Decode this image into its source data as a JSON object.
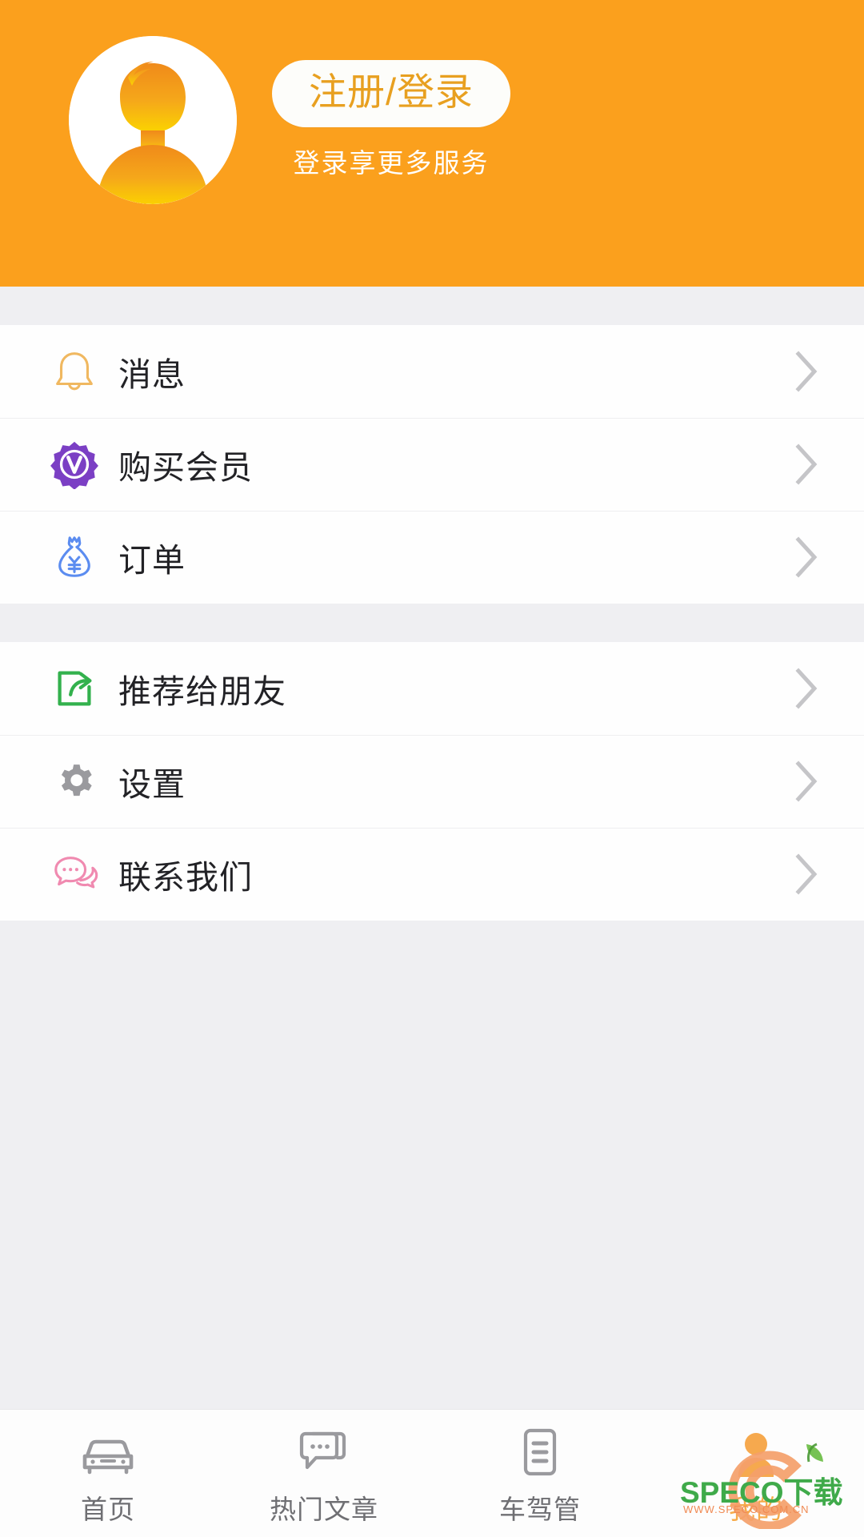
{
  "theme": {
    "brand_orange": "#fba01d",
    "page_bg": "#efeff2",
    "row_bg": "#fefefe",
    "divider": "#eeeef0",
    "label_color": "#222226",
    "chevron_color": "#c5c5c8",
    "active_tab_color": "#f6ab4a",
    "inactive_tab_color": "#6f6f73"
  },
  "header": {
    "avatar_icon": "default-user-avatar-icon",
    "login_button_label": "注册/登录",
    "login_subtitle": "登录享更多服务"
  },
  "menu": {
    "groups": [
      {
        "items": [
          {
            "icon": "bell-icon",
            "icon_color": "#f0b860",
            "label": "消息",
            "chevron": "chevron-right-icon"
          },
          {
            "icon": "vip-badge-icon",
            "icon_color": "#7b3fc4",
            "label": "购买会员",
            "chevron": "chevron-right-icon"
          },
          {
            "icon": "money-bag-icon",
            "icon_color": "#5b8cf0",
            "label": "订单",
            "chevron": "chevron-right-icon"
          }
        ]
      },
      {
        "items": [
          {
            "icon": "share-icon",
            "icon_color": "#33b14d",
            "label": "推荐给朋友",
            "chevron": "chevron-right-icon"
          },
          {
            "icon": "gear-icon",
            "icon_color": "#9a9a9e",
            "label": "设置",
            "chevron": "chevron-right-icon"
          },
          {
            "icon": "chat-bubbles-icon",
            "icon_color": "#f08ab0",
            "label": "联系我们",
            "chevron": "chevron-right-icon"
          }
        ]
      }
    ]
  },
  "tabbar": {
    "tabs": [
      {
        "icon": "car-icon",
        "label": "首页",
        "active": false
      },
      {
        "icon": "chat-bubble-icon",
        "label": "热门文章",
        "active": false
      },
      {
        "icon": "document-icon",
        "label": "车驾管",
        "active": false
      },
      {
        "icon": "person-icon",
        "label": "我的",
        "active": true
      }
    ]
  },
  "watermark": {
    "title": "SPECO下载",
    "url": "WWW.SPECO.COM.CN",
    "logo_icon": "speco-leaf-logo-icon"
  }
}
